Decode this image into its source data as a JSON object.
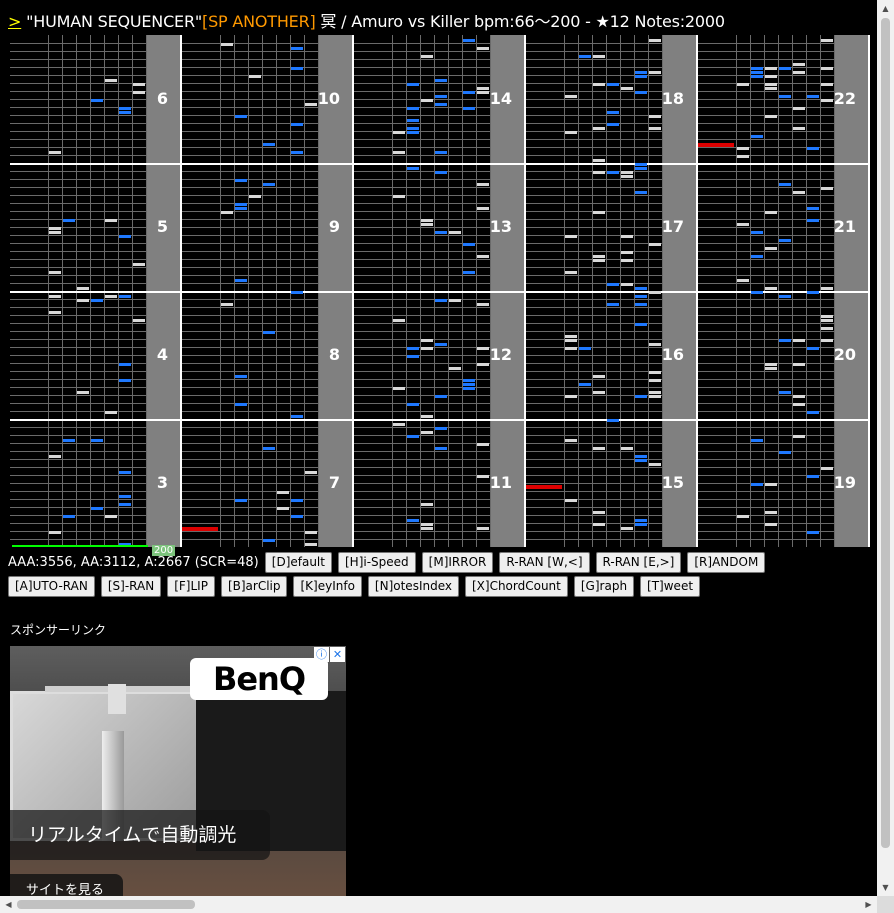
{
  "title": {
    "back_link": ">",
    "song": "\"HUMAN SEQUENCER\"",
    "difficulty": "[SP ANOTHER]",
    "rest": " 冥 / Amuro vs Killer bpm:66～200 - ★12 Notes:2000"
  },
  "chart": {
    "columns": [
      {
        "measures": [
          6,
          5,
          4,
          3
        ]
      },
      {
        "measures": [
          10,
          9,
          8,
          7
        ]
      },
      {
        "measures": [
          14,
          13,
          12,
          11
        ]
      },
      {
        "measures": [
          18,
          17,
          16,
          15
        ]
      },
      {
        "measures": [
          22,
          21,
          20,
          19
        ]
      }
    ],
    "bpm_marker": "200",
    "colors": {
      "white_key": "#d8d8d8",
      "black_key": "#1e78ff",
      "scratch": "#dd0000",
      "scratch_lane": "#808080"
    }
  },
  "scores": {
    "text": "AAA:3556, AA:3112, A:2667 (SCR=48)"
  },
  "buttons_row1": [
    "[D]efault",
    "[H]i-Speed",
    "[M]IRROR",
    "R-RAN [W,<]",
    "R-RAN [E,>]",
    "[R]ANDOM"
  ],
  "buttons_row2": [
    "[A]UTO-RAN",
    "[S]-RAN",
    "[F]LIP",
    "[B]arClip",
    "[K]eyInfo",
    "[N]otesIndex",
    "[X]ChordCount",
    "[G]raph",
    "[T]weet"
  ],
  "sponsor": {
    "label": "スポンサーリンク"
  },
  "ad": {
    "brand": "BenQ",
    "caption": "リアルタイムで自動調光",
    "cta": "サイトを見る",
    "adchoices_info": "ⓘ",
    "adchoices_close": "✕"
  }
}
